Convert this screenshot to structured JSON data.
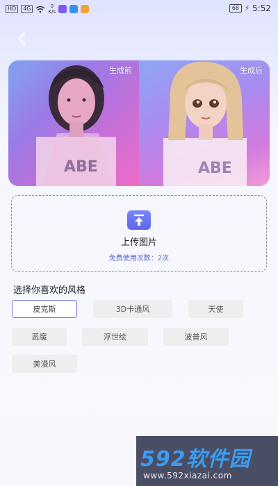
{
  "status_bar": {
    "network_badge_1": "HD",
    "network_badge_2": "4G",
    "speed_value": "0",
    "speed_unit": "K/s",
    "battery": "68",
    "time": "5:52"
  },
  "compare": {
    "before_label": "生成前",
    "after_label": "生成后",
    "after_shirt_text": "ABE",
    "before_shirt_text": "ABE"
  },
  "upload": {
    "title": "上传图片",
    "count_text": "免费使用次数：2次"
  },
  "styles_section": {
    "title": "选择你喜欢的风格",
    "options": [
      "皮克斯",
      "3D卡通风",
      "天使",
      "恶魔",
      "浮世绘",
      "波普风",
      "美漫风"
    ],
    "selected": "皮克斯"
  },
  "colors": {
    "accent": "#5b67ea",
    "selected_border": "#6b74e5"
  },
  "watermark": {
    "logo": "592软件园",
    "url": "www.592xiazai.com"
  }
}
